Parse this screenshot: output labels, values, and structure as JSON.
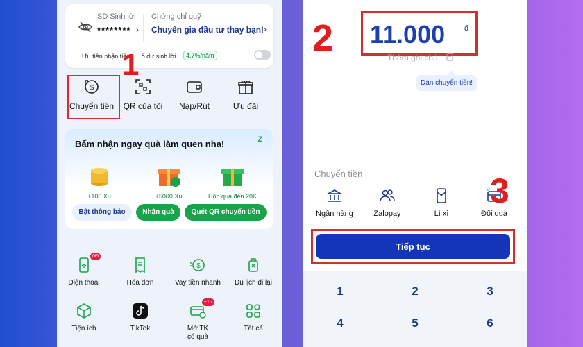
{
  "left": {
    "balance": {
      "label": "SD Sinh lời",
      "value": "********"
    },
    "fund": {
      "label": "Chứng chỉ quỹ",
      "value": "Chuyên gia đầu tư thay bạn!"
    },
    "priority": {
      "text_a": "Ưu tiên nhận tiền",
      "text_b": "ố dư sinh lời",
      "rate": "4.7%/năm"
    },
    "quick_actions": [
      {
        "label": "Chuyển tiền",
        "icon": "money-transfer-icon"
      },
      {
        "label": "QR của tôi",
        "icon": "qr-code-icon"
      },
      {
        "label": "Nạp/Rút",
        "icon": "wallet-icon"
      },
      {
        "label": "Ưu đãi",
        "icon": "gift-icon"
      }
    ],
    "promo": {
      "title": "Bấm nhận ngay quà làm quen nha!",
      "gifts": [
        {
          "caption": "+100 Xu",
          "icon": "coin-stack-icon"
        },
        {
          "caption": "+5000 Xu",
          "icon": "gift-box-icon"
        },
        {
          "caption": "Hộp quà đến 20K",
          "icon": "gift-box-icon"
        }
      ],
      "buttons": [
        "Bật thông báo",
        "Nhận quà",
        "Quét QR chuyển tiền"
      ]
    },
    "services": [
      {
        "label": "Điện thoại",
        "icon": "phone-icon",
        "badge": "0Đ"
      },
      {
        "label": "Hóa đơn",
        "icon": "bill-icon"
      },
      {
        "label": "Vay tiền nhanh",
        "icon": "loan-icon"
      },
      {
        "label": "Du lịch đi lại",
        "icon": "luggage-icon"
      },
      {
        "label": "Tiện ích",
        "icon": "box-icon"
      },
      {
        "label": "TikTok",
        "icon": "tiktok-icon"
      },
      {
        "label": "Mở TK\ncó quà",
        "icon": "card-icon",
        "badge": "+1tr"
      },
      {
        "label": "Tất cả",
        "icon": "grid-icon"
      }
    ]
  },
  "right": {
    "amount": "11.000",
    "currency": "đ",
    "note_placeholder": "Thêm ghi chú",
    "paste_tip": "Dán chuyển tiền!",
    "section_label": "Chuyển tiền",
    "methods": [
      {
        "label": "Ngân hàng",
        "icon": "bank-icon"
      },
      {
        "label": "Zalopay",
        "icon": "contacts-icon"
      },
      {
        "label": "Lì xì",
        "icon": "red-envelope-icon"
      },
      {
        "label": "Đổi quà",
        "icon": "gift-card-icon"
      }
    ],
    "continue_label": "Tiếp tục",
    "keys": [
      "1",
      "2",
      "3",
      "4",
      "5",
      "6"
    ]
  },
  "steps": [
    "1",
    "2",
    "3"
  ],
  "colors": {
    "accent": "#1535b8",
    "step_red": "#e11d1d",
    "promo_green": "#1aa34a"
  }
}
